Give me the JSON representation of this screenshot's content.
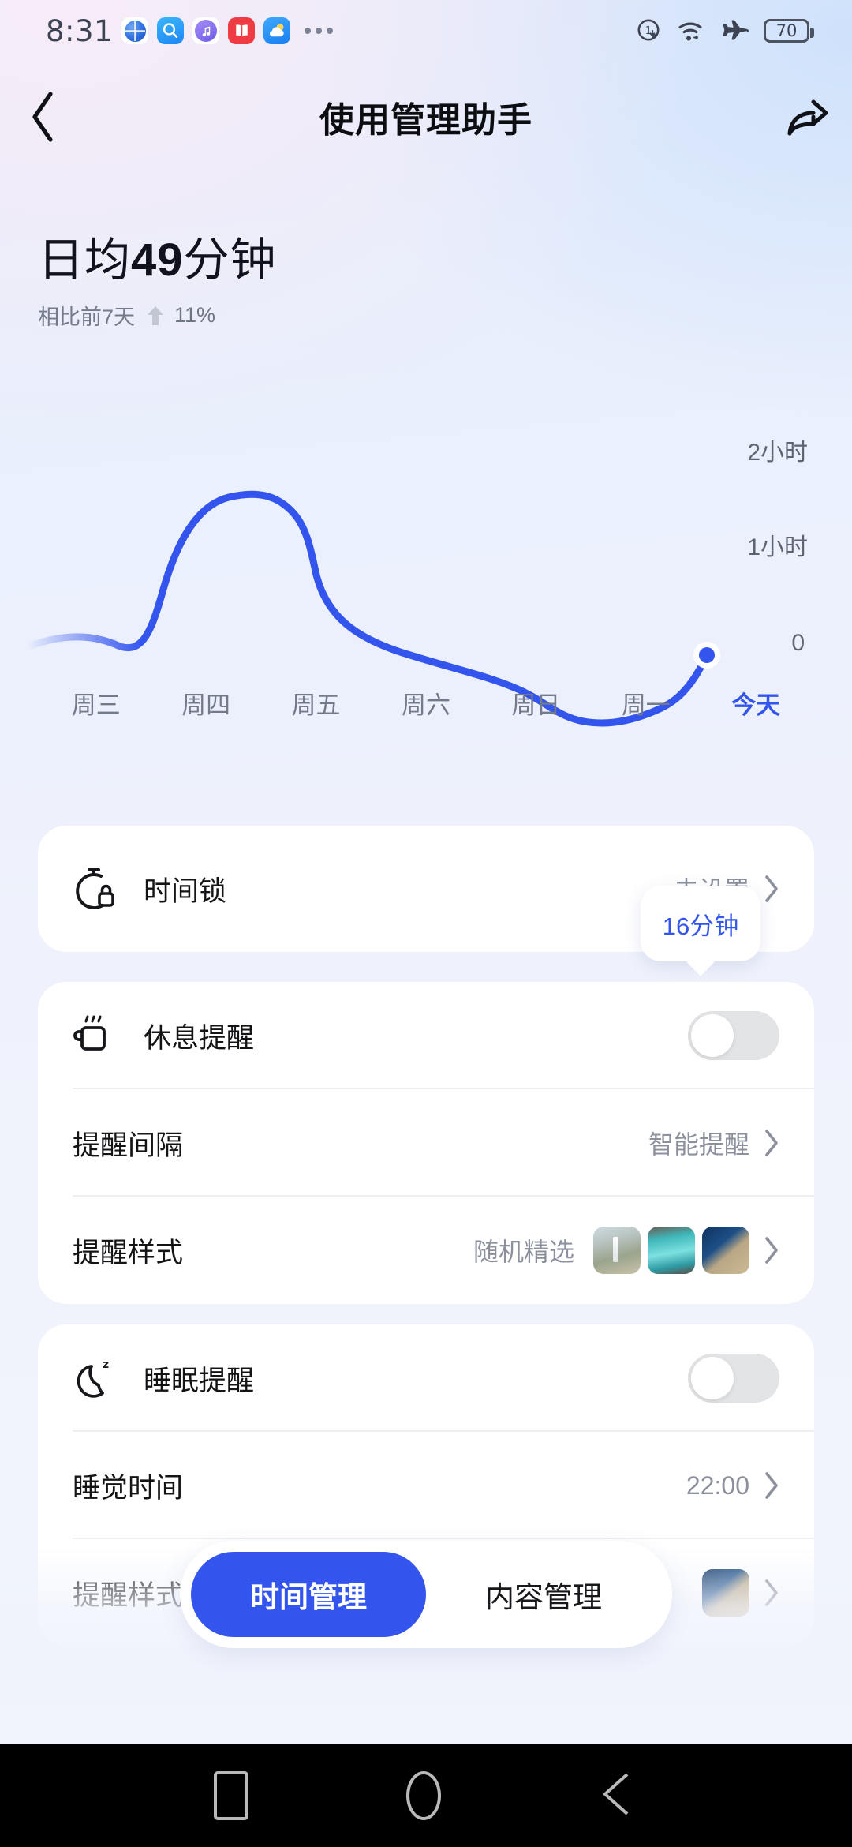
{
  "status_bar": {
    "time": "8:31",
    "app_icons": [
      "browser-icon",
      "search-icon",
      "music-icon",
      "book-icon",
      "weather-icon"
    ],
    "overflow": "…",
    "right_icons": [
      "data-saver-icon",
      "wifi-icon",
      "airplane-mode-icon"
    ],
    "battery_level": "70"
  },
  "header": {
    "title": "使用管理助手",
    "back_icon": "chevron-left-icon",
    "share_icon": "share-icon"
  },
  "hero": {
    "prefix": "日均",
    "value": "49",
    "unit": "分钟",
    "compare_label": "相比前7天",
    "trend_direction": "up",
    "trend_percent": "11%"
  },
  "chart_data": {
    "type": "line",
    "title": "",
    "xlabel": "",
    "ylabel": "",
    "categories": [
      "周三",
      "周四",
      "周五",
      "周六",
      "周日",
      "周一",
      "今天"
    ],
    "values": [
      18,
      108,
      112,
      72,
      40,
      8,
      16
    ],
    "value_unit": "分钟",
    "ytick_labels": [
      "2小时",
      "1小时",
      "0"
    ],
    "ytick_values": [
      120,
      60,
      0
    ],
    "ylim": [
      0,
      135
    ],
    "grid": false,
    "legend": "none",
    "line_color": "#3355ee",
    "highlight_index": 6,
    "highlight_label": "16分钟",
    "active_category": "今天"
  },
  "cards": {
    "time_lock": {
      "icon": "stopwatch-lock-icon",
      "label": "时间锁",
      "action_text": "去设置",
      "chevron": "chevron-right-icon"
    },
    "rest_reminder": {
      "icon": "coffee-cup-icon",
      "label": "休息提醒",
      "toggle_state": "off",
      "rows": [
        {
          "label": "提醒间隔",
          "value": "智能提醒",
          "chevron": "chevron-right-icon"
        },
        {
          "label": "提醒样式",
          "value": "随机精选",
          "chevron": "chevron-right-icon",
          "thumbnails": [
            "lighthouse-thumbnail",
            "waterfall-thumbnail",
            "coastline-thumbnail"
          ]
        }
      ]
    },
    "sleep_reminder": {
      "icon": "moon-zzz-icon",
      "label": "睡眠提醒",
      "toggle_state": "off",
      "rows": [
        {
          "label": "睡觉时间",
          "value": "22:00",
          "chevron": "chevron-right-icon"
        }
      ]
    },
    "partially_hidden_row": {
      "label": "提醒样式",
      "chevron": "chevron-right-icon"
    }
  },
  "tab_bar": {
    "tabs": [
      {
        "label": "时间管理",
        "active": true
      },
      {
        "label": "内容管理",
        "active": false
      }
    ]
  },
  "nav_bar": {
    "recents_icon": "recents-square-icon",
    "home_icon": "home-circle-icon",
    "back_icon": "back-triangle-icon"
  },
  "colors": {
    "accent": "#3355ee",
    "text_primary": "#141417",
    "text_secondary": "#8b909c",
    "card_bg": "#ffffff"
  }
}
